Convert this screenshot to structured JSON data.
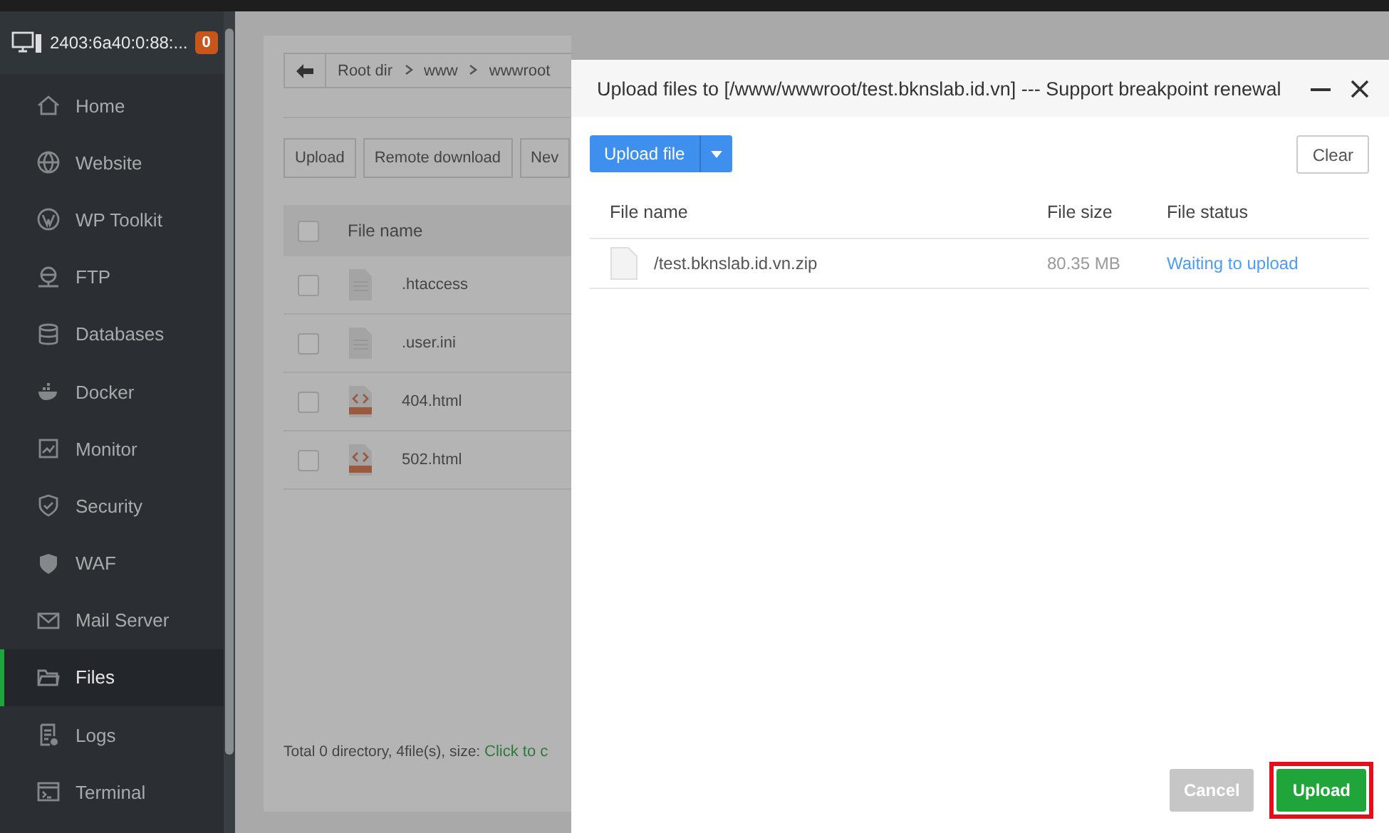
{
  "sidebar": {
    "host": "2403:6a40:0:88:...",
    "badge": "0",
    "items": [
      {
        "label": "Home",
        "selected": false
      },
      {
        "label": "Website",
        "selected": false
      },
      {
        "label": "WP Toolkit",
        "selected": false
      },
      {
        "label": "FTP",
        "selected": false
      },
      {
        "label": "Databases",
        "selected": false
      },
      {
        "label": "Docker",
        "selected": false
      },
      {
        "label": "Monitor",
        "selected": false
      },
      {
        "label": "Security",
        "selected": false
      },
      {
        "label": "WAF",
        "selected": false
      },
      {
        "label": "Mail Server",
        "selected": false
      },
      {
        "label": "Files",
        "selected": true
      },
      {
        "label": "Logs",
        "selected": false
      },
      {
        "label": "Terminal",
        "selected": false
      }
    ]
  },
  "file_manager": {
    "breadcrumb": [
      "Root dir",
      "www",
      "wwwroot"
    ],
    "toolbar": [
      "Upload",
      "Remote download",
      "Nev"
    ],
    "select_all_checked": false,
    "column": "File name",
    "files": [
      {
        "name": ".htaccess",
        "kind": "text",
        "checked": false
      },
      {
        "name": ".user.ini",
        "kind": "text",
        "checked": false
      },
      {
        "name": "404.html",
        "kind": "html",
        "checked": false
      },
      {
        "name": "502.html",
        "kind": "html",
        "checked": false
      }
    ],
    "footer": {
      "summary": "Total 0 directory, 4file(s), size:",
      "link": "Click to c"
    }
  },
  "dialog": {
    "title": "Upload files to [/www/wwwroot/test.bknslab.id.vn] --- Support breakpoint renewal",
    "upload_button": "Upload file",
    "clear_button": "Clear",
    "columns": [
      "File name",
      "File size",
      "File status"
    ],
    "files": [
      {
        "name": "/test.bknslab.id.vn.zip",
        "size": "80.35 MB",
        "status": "Waiting to upload"
      }
    ],
    "cancel_button": "Cancel",
    "confirm_button": "Upload"
  }
}
